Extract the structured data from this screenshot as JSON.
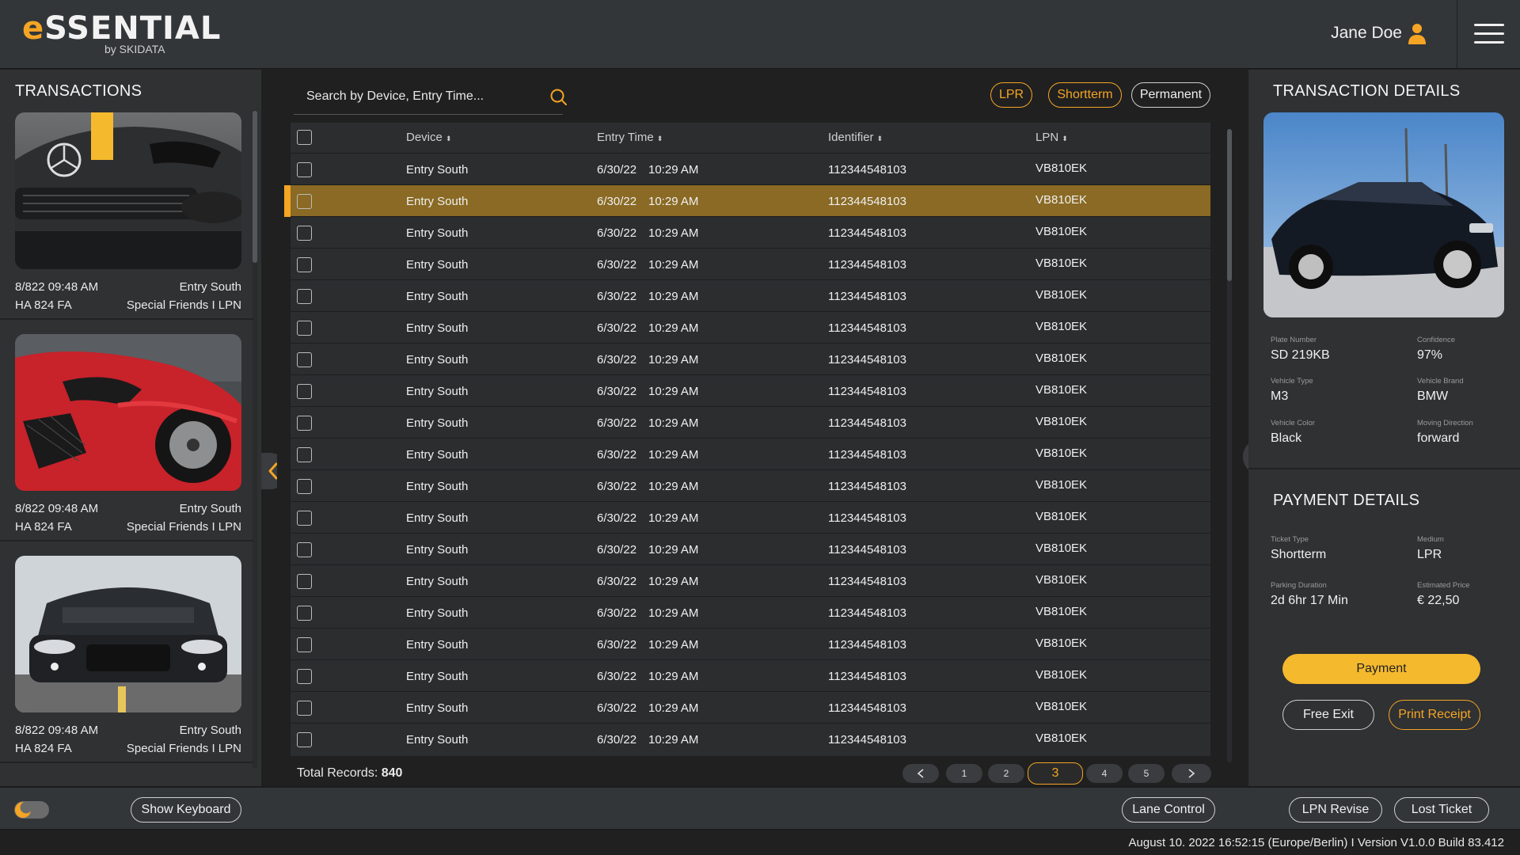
{
  "header": {
    "logo_main_initial": "e",
    "logo_main_rest": "SSENTIAL",
    "logo_sub": "by SKIDATA",
    "user_name": "Jane Doe",
    "user_icon": "user-icon",
    "menu_icon": "hamburger-menu-icon"
  },
  "colors": {
    "accent": "#f5a524",
    "selected_row": "#8a6a24",
    "panel": "#2f3133",
    "background": "#202020"
  },
  "transactions": {
    "title": "TRANSACTIONS",
    "items": [
      {
        "time": "8/822 09:48 AM",
        "device": "Entry South",
        "plate": "HA 824 FA",
        "group": "Special Friends I LPN"
      },
      {
        "time": "8/822 09:48 AM",
        "device": "Entry South",
        "plate": "HA 824 FA",
        "group": "Special Friends I LPN"
      },
      {
        "time": "8/822 09:48 AM",
        "device": "Entry South",
        "plate": "HA 824 FA",
        "group": "Special Friends I LPN"
      }
    ]
  },
  "search": {
    "placeholder": "Search by Device, Entry Time...",
    "icon": "search-icon"
  },
  "filters": {
    "lpr": "LPR",
    "shortterm": "Shortterm",
    "permanent": "Permanent"
  },
  "table": {
    "columns": {
      "device": "Device",
      "entry_time": "Entry Time",
      "identifier": "Identifier",
      "lpn": "LPN"
    },
    "sort_glyph": "⬍",
    "rows": [
      {
        "device": "Entry South",
        "date": "6/30/22",
        "time": "10:29 AM",
        "identifier": "112344548103",
        "lpn": "VB810EK"
      },
      {
        "device": "Entry South",
        "date": "6/30/22",
        "time": "10:29 AM",
        "identifier": "112344548103",
        "lpn": "VB810EK"
      },
      {
        "device": "Entry South",
        "date": "6/30/22",
        "time": "10:29 AM",
        "identifier": "112344548103",
        "lpn": "VB810EK"
      },
      {
        "device": "Entry South",
        "date": "6/30/22",
        "time": "10:29 AM",
        "identifier": "112344548103",
        "lpn": "VB810EK"
      },
      {
        "device": "Entry South",
        "date": "6/30/22",
        "time": "10:29 AM",
        "identifier": "112344548103",
        "lpn": "VB810EK"
      },
      {
        "device": "Entry South",
        "date": "6/30/22",
        "time": "10:29 AM",
        "identifier": "112344548103",
        "lpn": "VB810EK"
      },
      {
        "device": "Entry South",
        "date": "6/30/22",
        "time": "10:29 AM",
        "identifier": "112344548103",
        "lpn": "VB810EK"
      },
      {
        "device": "Entry South",
        "date": "6/30/22",
        "time": "10:29 AM",
        "identifier": "112344548103",
        "lpn": "VB810EK"
      },
      {
        "device": "Entry South",
        "date": "6/30/22",
        "time": "10:29 AM",
        "identifier": "112344548103",
        "lpn": "VB810EK"
      },
      {
        "device": "Entry South",
        "date": "6/30/22",
        "time": "10:29 AM",
        "identifier": "112344548103",
        "lpn": "VB810EK"
      },
      {
        "device": "Entry South",
        "date": "6/30/22",
        "time": "10:29 AM",
        "identifier": "112344548103",
        "lpn": "VB810EK"
      },
      {
        "device": "Entry South",
        "date": "6/30/22",
        "time": "10:29 AM",
        "identifier": "112344548103",
        "lpn": "VB810EK"
      },
      {
        "device": "Entry South",
        "date": "6/30/22",
        "time": "10:29 AM",
        "identifier": "112344548103",
        "lpn": "VB810EK"
      },
      {
        "device": "Entry South",
        "date": "6/30/22",
        "time": "10:29 AM",
        "identifier": "112344548103",
        "lpn": "VB810EK"
      },
      {
        "device": "Entry South",
        "date": "6/30/22",
        "time": "10:29 AM",
        "identifier": "112344548103",
        "lpn": "VB810EK"
      },
      {
        "device": "Entry South",
        "date": "6/30/22",
        "time": "10:29 AM",
        "identifier": "112344548103",
        "lpn": "VB810EK"
      },
      {
        "device": "Entry South",
        "date": "6/30/22",
        "time": "10:29 AM",
        "identifier": "112344548103",
        "lpn": "VB810EK"
      },
      {
        "device": "Entry South",
        "date": "6/30/22",
        "time": "10:29 AM",
        "identifier": "112344548103",
        "lpn": "VB810EK"
      },
      {
        "device": "Entry South",
        "date": "6/30/22",
        "time": "10:29 AM",
        "identifier": "112344548103",
        "lpn": "VB810EK"
      }
    ],
    "selected_row_index": 1
  },
  "pagination": {
    "total_label": "Total Records:",
    "total_value": "840",
    "pages": [
      "1",
      "2",
      "3",
      "4",
      "5"
    ],
    "current_page": "3",
    "prev_icon": "chevron-left-icon",
    "next_icon": "chevron-right-icon"
  },
  "transaction_details": {
    "title": "TRANSACTION DETAILS",
    "fields": [
      {
        "label": "Plate Number",
        "value": "SD 219KB"
      },
      {
        "label": "Confidence",
        "value": "97%"
      },
      {
        "label": "Vehicle Type",
        "value": "M3"
      },
      {
        "label": "Vehicle Brand",
        "value": "BMW"
      },
      {
        "label": "Vehicle Color",
        "value": "Black"
      },
      {
        "label": "Moving Direction",
        "value": "forward"
      }
    ]
  },
  "payment_details": {
    "title": "PAYMENT DETAILS",
    "fields": [
      {
        "label": "Ticket Type",
        "value": "Shortterm"
      },
      {
        "label": "Medium",
        "value": "LPR"
      },
      {
        "label": "Parking Duration",
        "value": "2d 6hr 17 Min"
      },
      {
        "label": "Estimated Price",
        "value": "€ 22,50"
      }
    ],
    "payment_button": "Payment",
    "free_exit_button": "Free Exit",
    "print_receipt_button": "Print Receipt"
  },
  "footer": {
    "theme_toggle_icon": "moon-icon",
    "show_keyboard": "Show Keyboard",
    "lane_control": "Lane Control",
    "lpn_revise": "LPN Revise",
    "lost_ticket": "Lost Ticket"
  },
  "status_bar": "August  10. 2022 16:52:15 (Europe/Berlin) I Version V1.0.0 Build 83.412"
}
